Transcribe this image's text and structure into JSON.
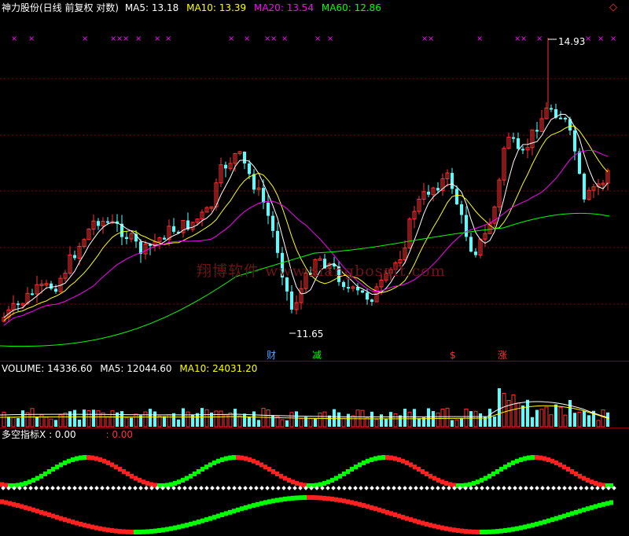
{
  "header": {
    "title": "神力股份(日线 前复权 对数)",
    "ma5_label": "MA5:",
    "ma5_value": "13.18",
    "ma10_label": "MA10:",
    "ma10_value": "13.39",
    "ma20_label": "MA20:",
    "ma20_value": "13.54",
    "ma60_label": "MA60:",
    "ma60_value": "12.86",
    "corner_icon": "◇"
  },
  "price_panel": {
    "high_annotation": "14.93",
    "low_annotation": "11.65",
    "events": [
      "财",
      "减",
      "$",
      "涨"
    ],
    "watermark": "翔博软件 www.xiangbosoft.com"
  },
  "volume_panel": {
    "volume_label": "VOLUME:",
    "volume_value": "14336.60",
    "ma5_label": "MA5:",
    "ma5_value": "12044.60",
    "ma10_label": "MA10:",
    "ma10_value": "24031.20"
  },
  "indicator_panel": {
    "name": "多空指标X",
    "value1": ": 0.00",
    "value2": ": 0.00"
  },
  "colors": {
    "up": "#ff3232",
    "down": "#54ffff",
    "ma5": "#ffffff",
    "ma10": "#ffff00",
    "ma20": "#ff00ff",
    "ma60": "#00ff00",
    "grid": "#8a0000"
  }
}
